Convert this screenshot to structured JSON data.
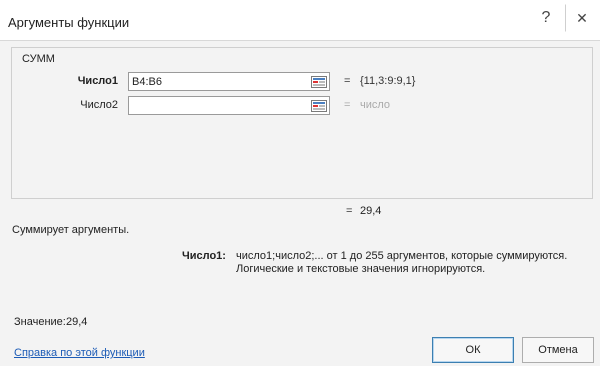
{
  "window": {
    "title": "Аргументы функции",
    "help_glyph": "?",
    "close_glyph": "✕"
  },
  "function": {
    "name": "СУММ"
  },
  "arguments": [
    {
      "label": "Число1",
      "value": "B4:B6",
      "eq": "=",
      "result": "{11,3:9:9,1}"
    },
    {
      "label": "Число2",
      "value": "",
      "eq": "=",
      "result": "число"
    }
  ],
  "result": {
    "eq": "=",
    "value": "29,4"
  },
  "description": "Суммирует аргументы.",
  "arg_help": {
    "name": "Число1:",
    "line1": "число1;число2;... от 1 до 255 аргументов, которые суммируются.",
    "line2": "Логические и текстовые значения игнорируются."
  },
  "footer": {
    "value_label": "Значение:",
    "value": "29,4",
    "help_link": "Справка по этой функции",
    "ok_label": "ОК",
    "cancel_label": "Отмена"
  },
  "icons": {
    "help": "help-icon",
    "close": "close-icon",
    "collapse": "collapse-dialog-icon"
  },
  "colors": {
    "link": "#1c5bb6",
    "dialog_bg": "#f3f3f3",
    "ok_border": "#3c7fb1"
  }
}
